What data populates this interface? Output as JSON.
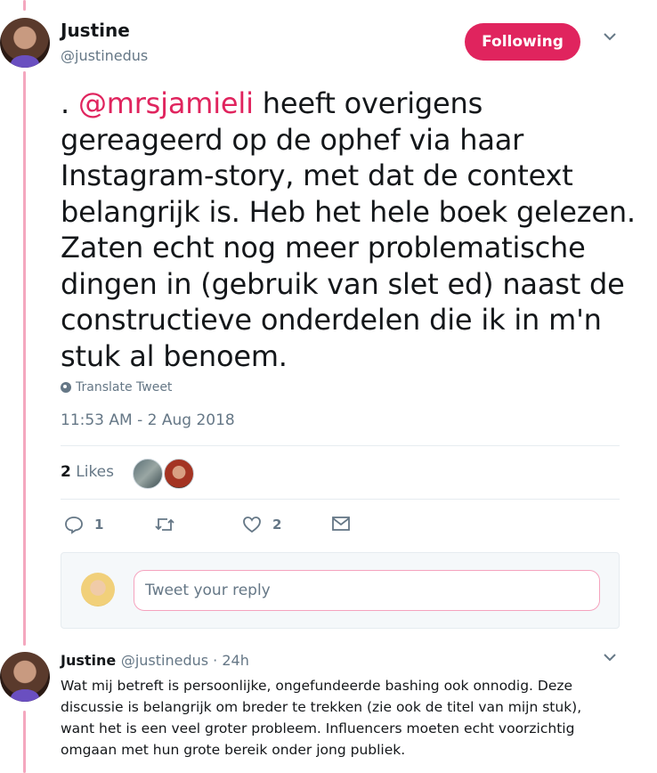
{
  "tweet": {
    "author_name": "Justine",
    "author_handle": "@justinedus",
    "follow_label": "Following",
    "text_prefix": ". ",
    "mention": "@mrsjamieli",
    "text_body": " heeft overigens gereageerd op de ophef via haar Instagram-story, met dat de context belangrijk is. Heb het hele boek gelezen. Zaten echt nog meer problematische dingen in (gebruik van slet ed) naast de constructieve onderdelen die ik in m'n stuk al benoem.",
    "translate_label": "Translate Tweet",
    "timestamp": "11:53 AM - 2 Aug 2018",
    "likes_count": "2",
    "likes_label": "Likes"
  },
  "actions": {
    "reply_count": "1",
    "like_count": "2"
  },
  "reply_box": {
    "placeholder": "Tweet your reply"
  },
  "reply_tweet": {
    "author_name": "Justine",
    "author_handle": "@justinedus",
    "separator": " · ",
    "time": "24h",
    "text": "Wat mij betreft is persoonlijke, ongefundeerde bashing ook onnodig. Deze discussie is belangrijk om breder te trekken (zie ook de titel van mijn stuk), want het is een veel groter probleem. Influencers moeten echt voorzichtig omgaan met hun grote bereik onder jong publiek."
  },
  "icons": {
    "accent": "#e0245e",
    "thread_line": "#f4a7be",
    "muted": "#657786"
  }
}
